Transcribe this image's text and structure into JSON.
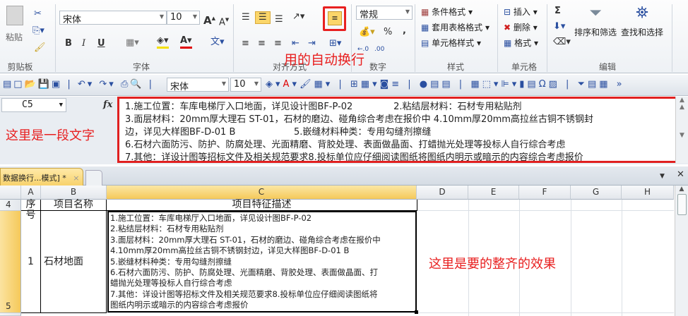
{
  "ribbon": {
    "clipboard": {
      "paste": "粘贴",
      "label": "剪贴板"
    },
    "font": {
      "name": "宋体",
      "size": "10",
      "bold": "B",
      "italic": "I",
      "underline": "U",
      "label": "字体"
    },
    "alignment": {
      "label": "对齐方式"
    },
    "number": {
      "format": "常规",
      "percent": "%",
      "comma": ",",
      "label": "数字"
    },
    "styles": {
      "conditional": "条件格式",
      "table": "套用表格格式",
      "cell": "单元格样式",
      "label": "样式"
    },
    "cells": {
      "insert": "插入",
      "delete": "删除",
      "format": "格式",
      "label": "单元格"
    },
    "editing": {
      "sum": "Σ",
      "sort": "排序和筛选",
      "find": "查找和选择",
      "label": "编辑"
    }
  },
  "quickbar": {
    "font": "宋体",
    "size": "10"
  },
  "formula": {
    "namebox": "C5",
    "fx": "fx",
    "lines": [
      "1.施工位置：车库电梯厅入口地面，详见设计图BF-P-02              2.粘结层材料：石材专用粘贴剂",
      "3.面层材料：20mm厚大理石 ST-01，石材的磨边、碰角综合考虑在报价中 4.10mm厚20mm高拉丝古铜不锈钢封",
      "边，详见大样图BF-D-01 B                    5.嵌缝材料种类：专用勾缝剂擦缝",
      "6.石材六面防污、防护、防腐处理、光面精磨、背胶处理、表面做晶面、打蜡抛光处理等投标人自行综合考虑",
      "7.其他：详设计图等招标文件及相关规范要求8.投标单位应仔细阅读图纸将图纸内明示或暗示的内容综合考虑报价"
    ]
  },
  "tab": {
    "name": "数据换行...模式] *",
    "close": "×"
  },
  "grid": {
    "columns": [
      "A",
      "B",
      "C",
      "D",
      "E",
      "F",
      "G",
      "H"
    ],
    "rows": [
      "4",
      "5"
    ],
    "header": {
      "a": "序号",
      "b": "项目名称",
      "c": "项目特征描述"
    },
    "row5": {
      "a": "1",
      "b": "石材地面",
      "c": [
        "1.施工位置：车库电梯厅入口地面，详见设计图BF-P-02",
        "2.粘结层材料：石材专用粘贴剂",
        "3.面层材料：20mm厚大理石 ST-01，石材的磨边、碰角综合考虑在报价中",
        "4.10mm厚20mm高拉丝古铜不锈钢封边，详见大样图BF-D-01 B",
        "5.嵌缝材料种类：专用勾缝剂擦缝",
        "6.石材六面防污、防护、防腐处理、光面精磨、背胶处理、表面做晶面、打",
        "蜡抛光处理等投标人自行综合考虑",
        "7.其他：详设计图等招标文件及相关规范要求8.投标单位应仔细阅读图纸将",
        "图纸内明示或暗示的内容综合考虑报价"
      ]
    }
  },
  "annotations": {
    "wrap": "用的自动换行",
    "text": "这里是一段文字",
    "effect": "这里是要的整齐的效果"
  },
  "colors": {
    "accent": "#e82020",
    "selected": "#f5c95a"
  }
}
